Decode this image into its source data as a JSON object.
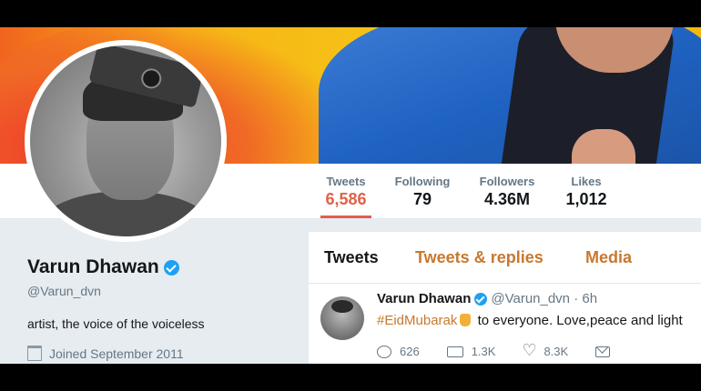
{
  "profile": {
    "name": "Varun Dhawan",
    "handle": "@Varun_dvn",
    "bio": "artist, the voice of the voiceless",
    "joined": "Joined September 2011"
  },
  "stats": [
    {
      "label": "Tweets",
      "value": "6,586"
    },
    {
      "label": "Following",
      "value": "79"
    },
    {
      "label": "Followers",
      "value": "4.36M"
    },
    {
      "label": "Likes",
      "value": "1,012"
    }
  ],
  "tabs": [
    "Tweets",
    "Tweets & replies",
    "Media"
  ],
  "tweet": {
    "name": "Varun Dhawan",
    "handle": "@Varun_dvn",
    "time": "6h",
    "hashtag": "#EidMubarak",
    "text": "to everyone. Love,peace and light",
    "replies": "626",
    "retweets": "1.3K",
    "likes": "8.3K"
  },
  "colors": {
    "accent": "#e0604a",
    "link": "#c8782f",
    "verified": "#1da1f2"
  },
  "icons": [
    "verified-badge-icon",
    "calendar-icon",
    "reply-icon",
    "retweet-icon",
    "like-icon",
    "direct-message-icon"
  ]
}
